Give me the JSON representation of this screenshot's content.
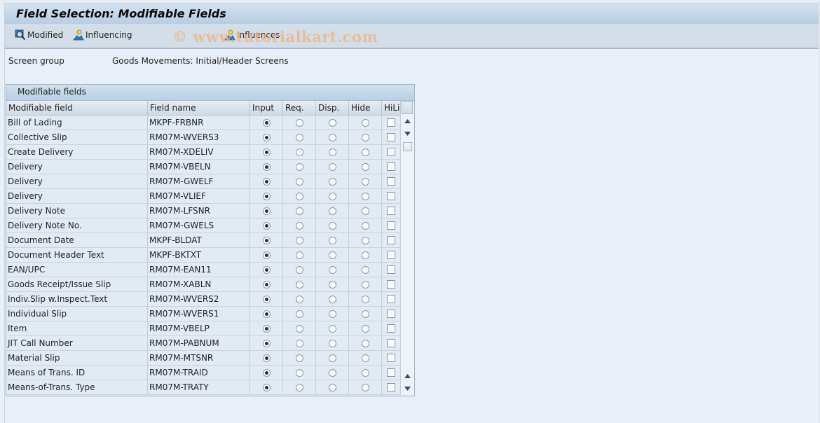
{
  "window": {
    "title": "Field Selection: Modifiable Fields"
  },
  "toolbar": {
    "buttons": [
      {
        "label": "Modified",
        "icon": "magnifier-icon"
      },
      {
        "label": "Influencing",
        "icon": "person-icon"
      },
      {
        "label": "Influences",
        "icon": "person-icon"
      }
    ],
    "watermark": "© www.tutorialkart.com"
  },
  "screen_group": {
    "label": "Screen group",
    "value": "Goods Movements: Initial/Header Screens"
  },
  "table": {
    "title": "Modifiable fields",
    "columns": [
      "Modifiable field",
      "Field name",
      "Input",
      "Req.",
      "Disp.",
      "Hide",
      "HiLi"
    ],
    "rows": [
      {
        "field": "Bill of Lading",
        "name": "MKPF-FRBNR",
        "selected": "Input",
        "hili": false
      },
      {
        "field": "Collective Slip",
        "name": "RM07M-WVERS3",
        "selected": "Input",
        "hili": false
      },
      {
        "field": "Create Delivery",
        "name": "RM07M-XDELIV",
        "selected": "Input",
        "hili": false
      },
      {
        "field": "Delivery",
        "name": "RM07M-VBELN",
        "selected": "Input",
        "hili": false
      },
      {
        "field": "Delivery",
        "name": "RM07M-GWELF",
        "selected": "Input",
        "hili": false
      },
      {
        "field": "Delivery",
        "name": "RM07M-VLIEF",
        "selected": "Input",
        "hili": false
      },
      {
        "field": "Delivery Note",
        "name": "RM07M-LFSNR",
        "selected": "Input",
        "hili": false
      },
      {
        "field": "Delivery Note No.",
        "name": "RM07M-GWELS",
        "selected": "Input",
        "hili": false
      },
      {
        "field": "Document Date",
        "name": "MKPF-BLDAT",
        "selected": "Input",
        "hili": false
      },
      {
        "field": "Document Header Text",
        "name": "MKPF-BKTXT",
        "selected": "Input",
        "hili": false
      },
      {
        "field": "EAN/UPC",
        "name": "RM07M-EAN11",
        "selected": "Input",
        "hili": false
      },
      {
        "field": "Goods Receipt/Issue Slip",
        "name": "RM07M-XABLN",
        "selected": "Input",
        "hili": false
      },
      {
        "field": "Indiv.Slip w.Inspect.Text",
        "name": "RM07M-WVERS2",
        "selected": "Input",
        "hili": false
      },
      {
        "field": "Individual Slip",
        "name": "RM07M-WVERS1",
        "selected": "Input",
        "hili": false
      },
      {
        "field": "Item",
        "name": "RM07M-VBELP",
        "selected": "Input",
        "hili": false
      },
      {
        "field": "JIT Call Number",
        "name": "RM07M-PABNUM",
        "selected": "Input",
        "hili": false
      },
      {
        "field": "Material Slip",
        "name": "RM07M-MTSNR",
        "selected": "Input",
        "hili": false
      },
      {
        "field": "Means of Trans. ID",
        "name": "RM07M-TRAID",
        "selected": "Input",
        "hili": false
      },
      {
        "field": "Means-of-Trans. Type",
        "name": "RM07M-TRATY",
        "selected": "Input",
        "hili": false
      }
    ]
  }
}
